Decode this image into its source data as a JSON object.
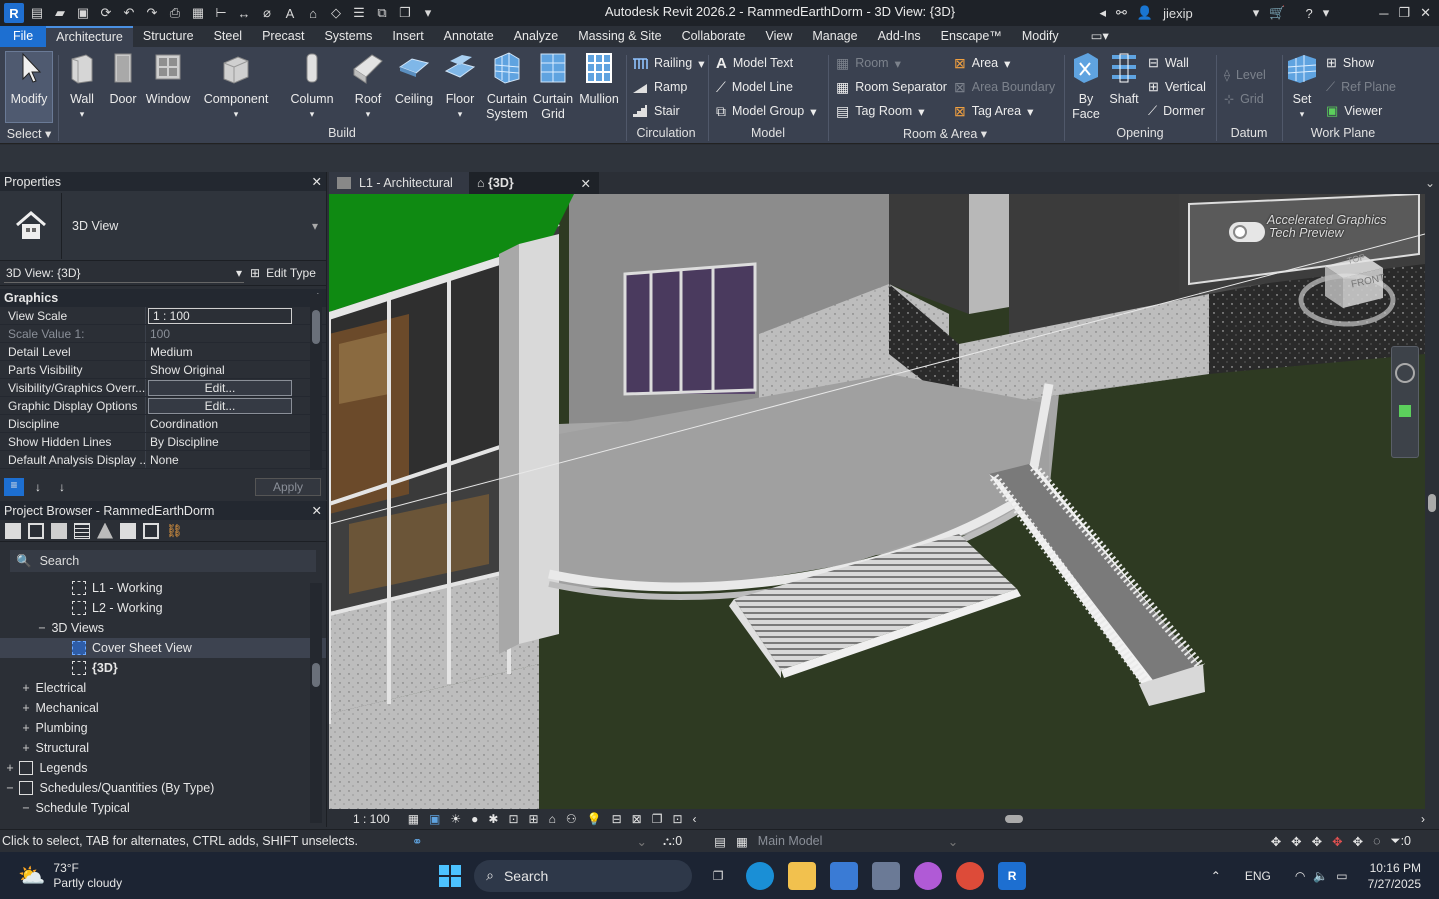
{
  "app": {
    "title": "Autodesk Revit 2026.2 - RammedEarthDorm - 3D View: {3D}",
    "user": "jiexip",
    "logo_letter": "R"
  },
  "menu_tabs": [
    "File",
    "Architecture",
    "Structure",
    "Steel",
    "Precast",
    "Systems",
    "Insert",
    "Annotate",
    "Analyze",
    "Massing & Site",
    "Collaborate",
    "View",
    "Manage",
    "Add-Ins",
    "Enscape™",
    "Modify"
  ],
  "ribbon": {
    "select": {
      "modify": "Modify",
      "label": "Select"
    },
    "build": {
      "wall": "Wall",
      "door": "Door",
      "window": "Window",
      "component": "Component",
      "column": "Column",
      "roof": "Roof",
      "ceiling": "Ceiling",
      "floor": "Floor",
      "curtain_system_1": "Curtain",
      "curtain_system_2": "System",
      "curtain_grid_1": "Curtain",
      "curtain_grid_2": "Grid",
      "mullion": "Mullion",
      "label": "Build"
    },
    "circulation": {
      "railing": "Railing",
      "ramp": "Ramp",
      "stair": "Stair",
      "label": "Circulation"
    },
    "model": {
      "text": "Model Text",
      "line": "Model Line",
      "group": "Model Group",
      "label": "Model"
    },
    "room_area": {
      "room": "Room",
      "room_separator": "Room Separator",
      "tag_room": "Tag Room",
      "area": "Area",
      "area_boundary": "Area Boundary",
      "tag_area": "Tag Area",
      "label": "Room & Area"
    },
    "opening": {
      "by_face_1": "By",
      "by_face_2": "Face",
      "shaft": "Shaft",
      "wall": "Wall",
      "vertical": "Vertical",
      "dormer": "Dormer",
      "label": "Opening"
    },
    "datum": {
      "level": "Level",
      "grid": "Grid",
      "label": "Datum"
    },
    "work_plane": {
      "set": "Set",
      "show": "Show",
      "ref_plane": "Ref Plane",
      "viewer": "Viewer",
      "label": "Work Plane"
    }
  },
  "properties": {
    "title": "Properties",
    "type_name": "3D View",
    "selector": "3D View: {3D}",
    "edit_type": "Edit Type",
    "group": "Graphics",
    "rows": [
      {
        "k": "View Scale",
        "v": "1 : 100"
      },
      {
        "k": "Scale Value    1:",
        "v": "100"
      },
      {
        "k": "Detail Level",
        "v": "Medium"
      },
      {
        "k": "Parts Visibility",
        "v": "Show Original"
      },
      {
        "k": "Visibility/Graphics Overr...",
        "v": "Edit..."
      },
      {
        "k": "Graphic Display Options",
        "v": "Edit..."
      },
      {
        "k": "Discipline",
        "v": "Coordination"
      },
      {
        "k": "Show Hidden Lines",
        "v": "By Discipline"
      },
      {
        "k": "Default Analysis Display ...",
        "v": "None"
      }
    ],
    "apply": "Apply"
  },
  "browser": {
    "title": "Project Browser - RammedEarthDorm",
    "search": "Search",
    "items": [
      {
        "label": "L1 - Working",
        "toggle": ""
      },
      {
        "label": "L2 - Working",
        "toggle": ""
      },
      {
        "label": "3D Views",
        "toggle": "−"
      },
      {
        "label": "Cover Sheet View",
        "toggle": ""
      },
      {
        "label": "{3D}",
        "toggle": ""
      },
      {
        "label": "Electrical",
        "toggle": "+"
      },
      {
        "label": "Mechanical",
        "toggle": "+"
      },
      {
        "label": "Plumbing",
        "toggle": "+"
      },
      {
        "label": "Structural",
        "toggle": "+"
      },
      {
        "label": "Legends",
        "toggle": "+"
      },
      {
        "label": "Schedules/Quantities (By Type)",
        "toggle": "−"
      },
      {
        "label": "Schedule Typical",
        "toggle": "−"
      }
    ]
  },
  "view_tabs": [
    {
      "label": "L1 - Architectural"
    },
    {
      "label": "{3D}"
    }
  ],
  "viewport": {
    "watermark_1": "Accelerated Graphics",
    "watermark_2": "Tech Preview",
    "viewcube_front": "FRONT",
    "viewcube_top": "TOP"
  },
  "view_control": {
    "scale": "1 : 100"
  },
  "status": {
    "hint": "Click to select, TAB for alternates, CTRL adds, SHIFT unselects.",
    "worksets": ":0",
    "model": "Main Model",
    "filter": ":0"
  },
  "taskbar": {
    "temp": "73°F",
    "weather": "Partly cloudy",
    "search": "Search",
    "lang": "ENG",
    "time": "10:16 PM",
    "date": "7/27/2025"
  },
  "colors": {
    "accent": "#1d6fd1",
    "ribbon": "#3a4150",
    "grass": "#2e3a22",
    "roof": "#0f8a12"
  }
}
